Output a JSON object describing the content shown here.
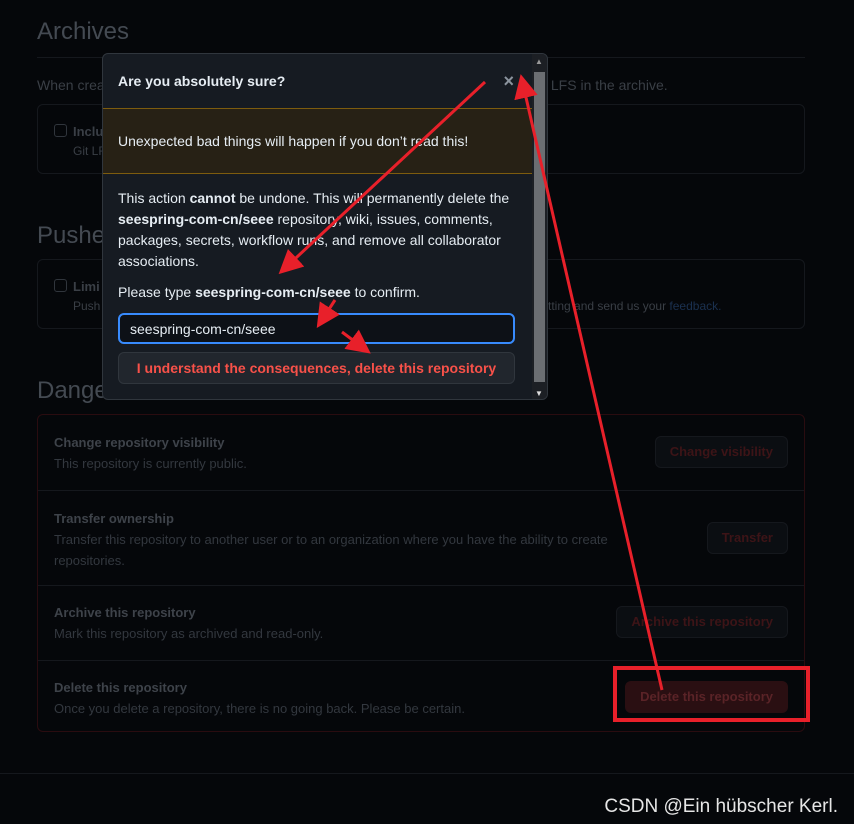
{
  "background": {
    "archives_title": "Archives",
    "archives_desc_left": "When crea",
    "archives_desc_right": "it LFS in the archive.",
    "include_label": "Inclu",
    "include_sub": "Git LF",
    "pushes_title": "Pushe",
    "limit_label": "Limi",
    "limit_sub": "Push",
    "limit_sub_right": "tting and send us your",
    "feedback_link": "feedback.",
    "danger_title": "Dange"
  },
  "danger_zone": [
    {
      "title": "Change repository visibility",
      "desc": "This repository is currently public.",
      "button": "Change visibility"
    },
    {
      "title": "Transfer ownership",
      "desc": "Transfer this repository to another user or to an organization where you have the ability to create repositories.",
      "button": "Transfer"
    },
    {
      "title": "Archive this repository",
      "desc": "Mark this repository as archived and read-only.",
      "button": "Archive this repository"
    },
    {
      "title": "Delete this repository",
      "desc": "Once you delete a repository, there is no going back. Please be certain.",
      "button": "Delete this repository"
    }
  ],
  "modal": {
    "title": "Are you absolutely sure?",
    "close_icon": "×",
    "warning": "Unexpected bad things will happen if you don’t read this!",
    "p1_a": "This action ",
    "p1_b": "cannot",
    "p1_c": " be undone. This will permanently delete the ",
    "p1_repo": "seespring-com-cn/seee",
    "p1_d": " repository, wiki, issues, comments, packages, secrets, workflow runs, and remove all collaborator associations.",
    "p2_a": "Please type ",
    "p2_repo": "seespring-com-cn/seee",
    "p2_b": " to confirm.",
    "input_value": "seespring-com-cn/seee",
    "confirm_button": "I understand the consequences, delete this repository"
  },
  "watermark": "CSDN @Ein hübscher Kerl.",
  "colors": {
    "annotation": "#e8202a",
    "danger": "#f85149",
    "focus": "#388bfd"
  }
}
